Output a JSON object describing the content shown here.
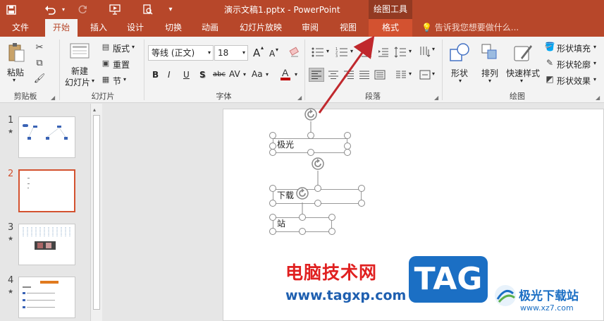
{
  "window": {
    "title": "演示文稿1.pptx - PowerPoint",
    "context_tool": "绘图工具"
  },
  "tabs": [
    "文件",
    "开始",
    "插入",
    "设计",
    "切换",
    "动画",
    "幻灯片放映",
    "审阅",
    "视图",
    "格式"
  ],
  "active_tab": "开始",
  "tell_me": "告诉我您想要做什么...",
  "ribbon": {
    "clipboard": {
      "paste": "粘贴",
      "label": "剪贴板"
    },
    "slides": {
      "new_slide_l1": "新建",
      "new_slide_l2": "幻灯片",
      "layout": "版式",
      "reset": "重置",
      "section": "节",
      "label": "幻灯片"
    },
    "font": {
      "name": "等线 (正文)",
      "size": "18",
      "label": "字体",
      "bold": "B",
      "italic": "I",
      "underline": "U",
      "shadow": "S",
      "strike": "abc",
      "spacing": "AV",
      "case": "Aa",
      "grow": "A",
      "shrink": "A"
    },
    "paragraph": {
      "label": "段落"
    },
    "drawing": {
      "shape": "形状",
      "arrange": "排列",
      "quick_style": "快速样式",
      "fill": "形状填充",
      "outline": "形状轮廓",
      "effect": "形状效果",
      "label": "绘图"
    }
  },
  "thumbnails": [
    {
      "num": "1",
      "star": "★"
    },
    {
      "num": "2",
      "star": ""
    },
    {
      "num": "3",
      "star": "★"
    },
    {
      "num": "4",
      "star": "★"
    }
  ],
  "slide": {
    "box1": "极光",
    "box2": "下载",
    "box3": "站"
  },
  "watermark": {
    "line1": "电脑技术网",
    "line2": "www.tagxp.com",
    "tag": "TAG",
    "site": "极光下载站",
    "site_url": "www.xz7.com"
  },
  "colors": {
    "accent": "#b7472a",
    "context_tab": "#d35230",
    "arrow": "#c0282d"
  }
}
